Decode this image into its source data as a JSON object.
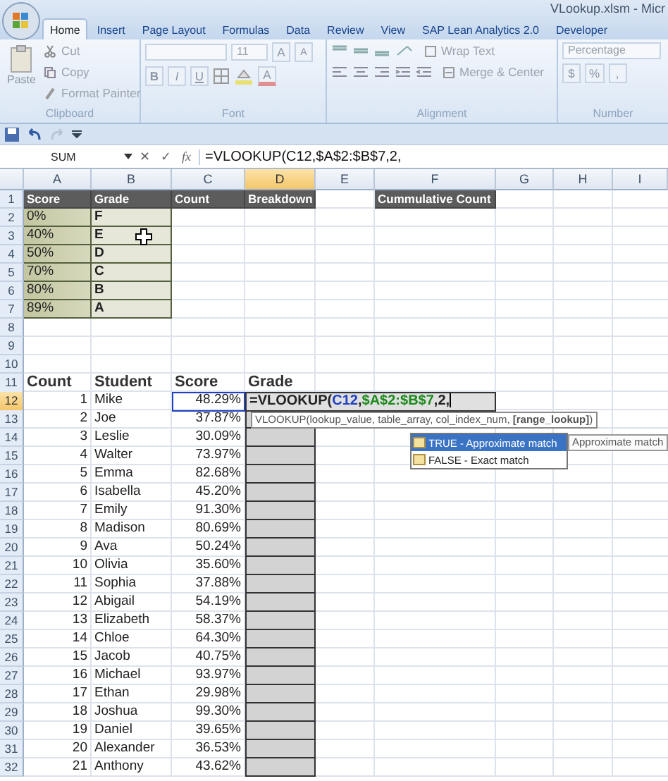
{
  "window": {
    "title": "VLookup.xlsm - Micr"
  },
  "tabs": [
    {
      "label": "Home",
      "selected": true
    },
    {
      "label": "Insert",
      "selected": false
    },
    {
      "label": "Page Layout",
      "selected": false
    },
    {
      "label": "Formulas",
      "selected": false
    },
    {
      "label": "Data",
      "selected": false
    },
    {
      "label": "Review",
      "selected": false
    },
    {
      "label": "View",
      "selected": false
    },
    {
      "label": "SAP Lean Analytics 2.0",
      "selected": false
    },
    {
      "label": "Developer",
      "selected": false
    }
  ],
  "ribbon": {
    "clipboard": {
      "label": "Clipboard",
      "paste": "Paste",
      "cut": "Cut",
      "copy": "Copy",
      "format_painter": "Format Painter"
    },
    "font": {
      "label": "Font",
      "size": "11",
      "grow": "A",
      "shrink": "A",
      "bold": "B",
      "italic": "I",
      "underline": "U",
      "font_color_letter": "A"
    },
    "alignment": {
      "label": "Alignment",
      "wrap": "Wrap Text",
      "merge": "Merge & Center"
    },
    "number": {
      "label": "Number",
      "format": "Percentage",
      "currency": "$",
      "percent": "%",
      "comma": ","
    }
  },
  "formula_bar": {
    "name_box": "SUM",
    "cancel": "✕",
    "enter": "✓",
    "function": "fx",
    "formula": "=VLOOKUP(C12,$A$2:$B$7,2,"
  },
  "columns": [
    {
      "label": "A",
      "selected": false
    },
    {
      "label": "B",
      "selected": false
    },
    {
      "label": "C",
      "selected": false
    },
    {
      "label": "D",
      "selected": true
    },
    {
      "label": "E",
      "selected": false
    },
    {
      "label": "F",
      "selected": false
    },
    {
      "label": "G",
      "selected": false
    },
    {
      "label": "H",
      "selected": false
    },
    {
      "label": "I",
      "selected": false
    }
  ],
  "rows": [
    {
      "number": "1",
      "selected": false,
      "cells": [
        {
          "text": "Score",
          "kind": "header"
        },
        {
          "text": "Grade",
          "kind": "header"
        },
        {
          "text": "Count",
          "kind": "header"
        },
        {
          "text": "Breakdown",
          "kind": "header"
        },
        null,
        {
          "text": "Cummulative Count",
          "kind": "header"
        }
      ]
    },
    {
      "number": "2",
      "selected": false,
      "cells": [
        {
          "text": "0%",
          "kind": "score"
        },
        {
          "text": "F",
          "kind": "grade"
        }
      ]
    },
    {
      "number": "3",
      "selected": false,
      "cells": [
        {
          "text": "40%",
          "kind": "score"
        },
        {
          "text": "E",
          "kind": "grade"
        }
      ]
    },
    {
      "number": "4",
      "selected": false,
      "cells": [
        {
          "text": "50%",
          "kind": "score"
        },
        {
          "text": "D",
          "kind": "grade"
        }
      ]
    },
    {
      "number": "5",
      "selected": false,
      "cells": [
        {
          "text": "70%",
          "kind": "score"
        },
        {
          "text": "C",
          "kind": "grade"
        }
      ]
    },
    {
      "number": "6",
      "selected": false,
      "cells": [
        {
          "text": "80%",
          "kind": "score"
        },
        {
          "text": "B",
          "kind": "grade"
        }
      ]
    },
    {
      "number": "7",
      "selected": false,
      "cells": [
        {
          "text": "89%",
          "kind": "score"
        },
        {
          "text": "A",
          "kind": "grade"
        }
      ]
    },
    {
      "number": "8",
      "selected": false
    },
    {
      "number": "9",
      "selected": false
    },
    {
      "number": "10",
      "selected": false
    },
    {
      "number": "11",
      "selected": false,
      "cells": [
        {
          "text": "Count",
          "kind": "title"
        },
        {
          "text": "Student",
          "kind": "title"
        },
        {
          "text": "Score",
          "kind": "title"
        },
        {
          "text": "Grade",
          "kind": "title"
        }
      ]
    },
    {
      "number": "12",
      "selected": true,
      "cells": [
        {
          "text": "1",
          "kind": "number"
        },
        {
          "text": "Mike",
          "kind": "text"
        },
        {
          "text": "48.29%",
          "kind": "referenced"
        },
        {
          "kind": "formula",
          "parts": [
            {
              "text": "=VLOOKUP("
            },
            {
              "text": "C12",
              "color": "#2040c0"
            },
            {
              "text": ","
            },
            {
              "text": "$A$2:$B$7",
              "color": "#1c8a1c"
            },
            {
              "text": ",2,"
            }
          ]
        }
      ]
    },
    {
      "number": "13",
      "selected": false,
      "cells": [
        {
          "text": "2",
          "kind": "number"
        },
        {
          "text": "Joe",
          "kind": "text"
        },
        {
          "text": "37.87%",
          "kind": "number"
        },
        {
          "kind": "shaded"
        }
      ]
    },
    {
      "number": "14",
      "selected": false,
      "cells": [
        {
          "text": "3",
          "kind": "number"
        },
        {
          "text": "Leslie",
          "kind": "text"
        },
        {
          "text": "30.09%",
          "kind": "number"
        },
        {
          "kind": "shaded"
        }
      ]
    },
    {
      "number": "15",
      "selected": false,
      "cells": [
        {
          "text": "4",
          "kind": "number"
        },
        {
          "text": "Walter",
          "kind": "text"
        },
        {
          "text": "73.97%",
          "kind": "number"
        },
        {
          "kind": "shaded"
        }
      ]
    },
    {
      "number": "16",
      "selected": false,
      "cells": [
        {
          "text": "5",
          "kind": "number"
        },
        {
          "text": "Emma",
          "kind": "text"
        },
        {
          "text": "82.68%",
          "kind": "number"
        },
        {
          "kind": "shaded"
        }
      ]
    },
    {
      "number": "17",
      "selected": false,
      "cells": [
        {
          "text": "6",
          "kind": "number"
        },
        {
          "text": "Isabella",
          "kind": "text"
        },
        {
          "text": "45.20%",
          "kind": "number"
        },
        {
          "kind": "shaded"
        }
      ]
    },
    {
      "number": "18",
      "selected": false,
      "cells": [
        {
          "text": "7",
          "kind": "number"
        },
        {
          "text": "Emily",
          "kind": "text"
        },
        {
          "text": "91.30%",
          "kind": "number"
        },
        {
          "kind": "shaded"
        }
      ]
    },
    {
      "number": "19",
      "selected": false,
      "cells": [
        {
          "text": "8",
          "kind": "number"
        },
        {
          "text": "Madison",
          "kind": "text"
        },
        {
          "text": "80.69%",
          "kind": "number"
        },
        {
          "kind": "shaded"
        }
      ]
    },
    {
      "number": "20",
      "selected": false,
      "cells": [
        {
          "text": "9",
          "kind": "number"
        },
        {
          "text": "Ava",
          "kind": "text"
        },
        {
          "text": "50.24%",
          "kind": "number"
        },
        {
          "kind": "shaded"
        }
      ]
    },
    {
      "number": "21",
      "selected": false,
      "cells": [
        {
          "text": "10",
          "kind": "number"
        },
        {
          "text": "Olivia",
          "kind": "text"
        },
        {
          "text": "35.60%",
          "kind": "number"
        },
        {
          "kind": "shaded"
        }
      ]
    },
    {
      "number": "22",
      "selected": false,
      "cells": [
        {
          "text": "11",
          "kind": "number"
        },
        {
          "text": "Sophia",
          "kind": "text"
        },
        {
          "text": "37.88%",
          "kind": "number"
        },
        {
          "kind": "shaded"
        }
      ]
    },
    {
      "number": "23",
      "selected": false,
      "cells": [
        {
          "text": "12",
          "kind": "number"
        },
        {
          "text": "Abigail",
          "kind": "text"
        },
        {
          "text": "54.19%",
          "kind": "number"
        },
        {
          "kind": "shaded"
        }
      ]
    },
    {
      "number": "24",
      "selected": false,
      "cells": [
        {
          "text": "13",
          "kind": "number"
        },
        {
          "text": "Elizabeth",
          "kind": "text"
        },
        {
          "text": "58.37%",
          "kind": "number"
        },
        {
          "kind": "shaded"
        }
      ]
    },
    {
      "number": "25",
      "selected": false,
      "cells": [
        {
          "text": "14",
          "kind": "number"
        },
        {
          "text": "Chloe",
          "kind": "text"
        },
        {
          "text": "64.30%",
          "kind": "number"
        },
        {
          "kind": "shaded"
        }
      ]
    },
    {
      "number": "26",
      "selected": false,
      "cells": [
        {
          "text": "15",
          "kind": "number"
        },
        {
          "text": "Jacob",
          "kind": "text"
        },
        {
          "text": "40.75%",
          "kind": "number"
        },
        {
          "kind": "shaded"
        }
      ]
    },
    {
      "number": "27",
      "selected": false,
      "cells": [
        {
          "text": "16",
          "kind": "number"
        },
        {
          "text": "Michael",
          "kind": "text"
        },
        {
          "text": "93.97%",
          "kind": "number"
        },
        {
          "kind": "shaded"
        }
      ]
    },
    {
      "number": "28",
      "selected": false,
      "cells": [
        {
          "text": "17",
          "kind": "number"
        },
        {
          "text": "Ethan",
          "kind": "text"
        },
        {
          "text": "29.98%",
          "kind": "number"
        },
        {
          "kind": "shaded"
        }
      ]
    },
    {
      "number": "29",
      "selected": false,
      "cells": [
        {
          "text": "18",
          "kind": "number"
        },
        {
          "text": "Joshua",
          "kind": "text"
        },
        {
          "text": "99.30%",
          "kind": "number"
        },
        {
          "kind": "shaded"
        }
      ]
    },
    {
      "number": "30",
      "selected": false,
      "cells": [
        {
          "text": "19",
          "kind": "number"
        },
        {
          "text": "Daniel",
          "kind": "text"
        },
        {
          "text": "39.65%",
          "kind": "number"
        },
        {
          "kind": "shaded"
        }
      ]
    },
    {
      "number": "31",
      "selected": false,
      "cells": [
        {
          "text": "20",
          "kind": "number"
        },
        {
          "text": "Alexander",
          "kind": "text"
        },
        {
          "text": "36.53%",
          "kind": "number"
        },
        {
          "kind": "shaded"
        }
      ]
    },
    {
      "number": "32",
      "selected": false,
      "cells": [
        {
          "text": "21",
          "kind": "number"
        },
        {
          "text": "Anthony",
          "kind": "text"
        },
        {
          "text": "43.62%",
          "kind": "number"
        },
        {
          "kind": "shaded"
        }
      ]
    }
  ],
  "function_tooltip": "VLOOKUP(lookup_value, table_array, col_index_num, **[range_lookup]**)",
  "autocomplete": [
    {
      "label": "TRUE - Approximate match",
      "selected": true
    },
    {
      "label": "FALSE - Exact match",
      "selected": false
    }
  ],
  "autocomplete_tip": "Approximate match"
}
